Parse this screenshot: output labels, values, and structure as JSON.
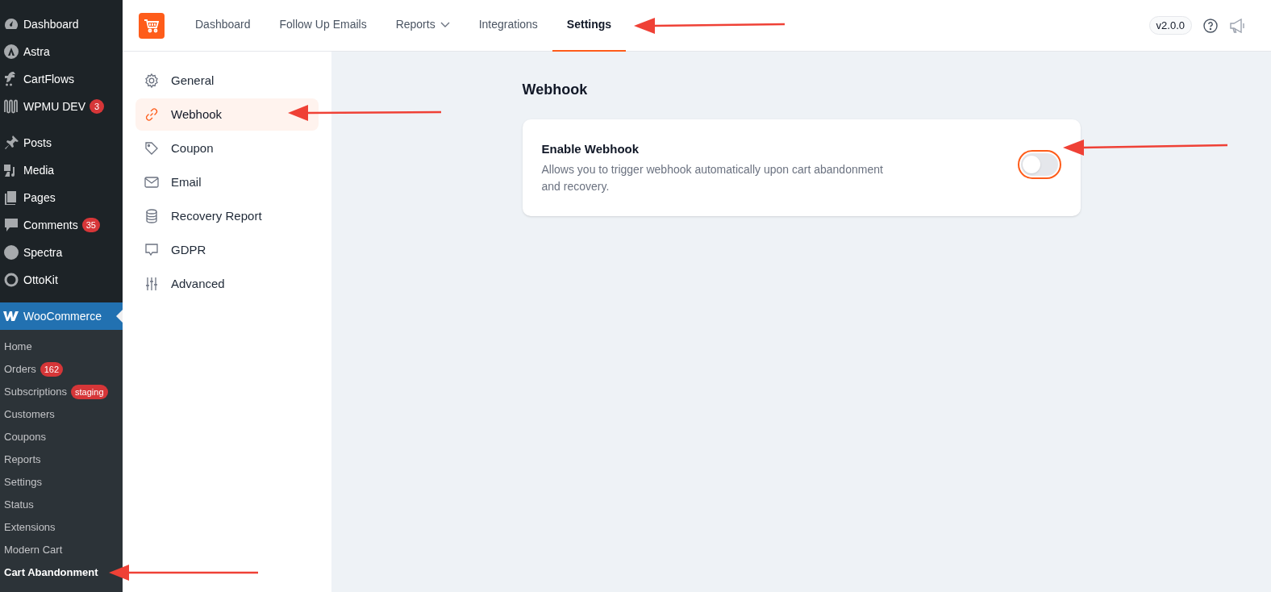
{
  "wp_sidebar": {
    "menu_groups": [
      [
        {
          "label": "Dashboard",
          "selected": false
        },
        {
          "label": "Astra",
          "selected": false
        },
        {
          "label": "CartFlows",
          "selected": false
        },
        {
          "label": "WPMU DEV",
          "badge": "3",
          "selected": false
        }
      ],
      [
        {
          "label": "Posts",
          "selected": false
        },
        {
          "label": "Media",
          "selected": false
        },
        {
          "label": "Pages",
          "selected": false
        },
        {
          "label": "Comments",
          "badge": "35",
          "selected": false
        },
        {
          "label": "Spectra",
          "selected": false
        },
        {
          "label": "OttoKit",
          "selected": false
        }
      ],
      [
        {
          "label": "WooCommerce",
          "selected": true
        }
      ]
    ],
    "submenu": [
      {
        "label": "Home",
        "selected": false
      },
      {
        "label": "Orders",
        "badge": "162",
        "selected": false
      },
      {
        "label": "Subscriptions",
        "badge": "staging",
        "selected": false
      },
      {
        "label": "Customers",
        "selected": false
      },
      {
        "label": "Coupons",
        "selected": false
      },
      {
        "label": "Reports",
        "selected": false
      },
      {
        "label": "Settings",
        "selected": false
      },
      {
        "label": "Status",
        "selected": false
      },
      {
        "label": "Extensions",
        "selected": false
      },
      {
        "label": "Modern Cart",
        "selected": false
      },
      {
        "label": "Cart Abandonment",
        "selected": true
      }
    ]
  },
  "header": {
    "tabs": [
      {
        "label": "Dashboard",
        "selected": false,
        "dropdown": false
      },
      {
        "label": "Follow Up Emails",
        "selected": false,
        "dropdown": false
      },
      {
        "label": "Reports",
        "selected": false,
        "dropdown": true
      },
      {
        "label": "Integrations",
        "selected": false,
        "dropdown": false
      },
      {
        "label": "Settings",
        "selected": true,
        "dropdown": false
      }
    ],
    "version": "v2.0.0"
  },
  "settings_nav": [
    {
      "label": "General",
      "selected": false
    },
    {
      "label": "Webhook",
      "selected": true
    },
    {
      "label": "Coupon",
      "selected": false
    },
    {
      "label": "Email",
      "selected": false
    },
    {
      "label": "Recovery Report",
      "selected": false
    },
    {
      "label": "GDPR",
      "selected": false
    },
    {
      "label": "Advanced",
      "selected": false
    }
  ],
  "content": {
    "title": "Webhook",
    "card": {
      "title": "Enable Webhook",
      "description": "Allows you to trigger webhook automatically upon cart abandonment and recovery.",
      "toggle": {
        "on": false
      }
    }
  }
}
